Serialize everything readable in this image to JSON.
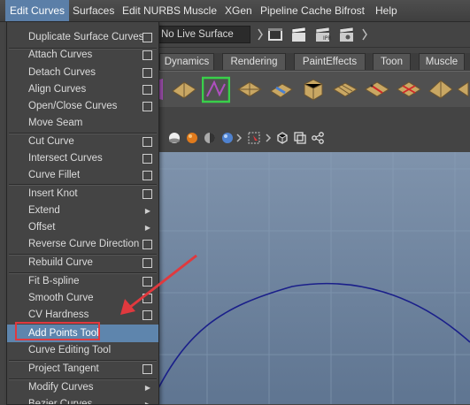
{
  "menubar": {
    "items": [
      {
        "label": "Edit Curves"
      },
      {
        "label": "Surfaces"
      },
      {
        "label": "Edit NURBS"
      },
      {
        "label": "Muscle"
      },
      {
        "label": "XGen"
      },
      {
        "label": "Pipeline Cache"
      },
      {
        "label": "Bifrost"
      },
      {
        "label": "Help"
      }
    ]
  },
  "statusline": {
    "live_surface": "No Live Surface"
  },
  "shelf_tabs": [
    "Dynamics",
    "Rendering",
    "PaintEffects",
    "Toon",
    "Muscle"
  ],
  "menu": {
    "items": [
      {
        "label": "Duplicate Surface Curves",
        "option_box": true
      },
      {
        "label": "Attach Curves",
        "option_box": true
      },
      {
        "label": "Detach Curves",
        "option_box": true
      },
      {
        "label": "Align Curves",
        "option_box": true
      },
      {
        "label": "Open/Close Curves",
        "option_box": true
      },
      {
        "label": "Move Seam",
        "option_box": false
      },
      {
        "label": "Cut Curve",
        "option_box": true
      },
      {
        "label": "Intersect Curves",
        "option_box": true
      },
      {
        "label": "Curve Fillet",
        "option_box": true
      },
      {
        "label": "Insert Knot",
        "option_box": true
      },
      {
        "label": "Extend",
        "submenu": true
      },
      {
        "label": "Offset",
        "submenu": true
      },
      {
        "label": "Reverse Curve Direction",
        "option_box": true
      },
      {
        "label": "Rebuild Curve",
        "option_box": true
      },
      {
        "label": "Fit B-spline",
        "option_box": true
      },
      {
        "label": "Smooth Curve",
        "option_box": true
      },
      {
        "label": "CV Hardness",
        "option_box": true
      },
      {
        "label": "Add Points Tool",
        "highlighted": true
      },
      {
        "label": "Curve Editing Tool"
      },
      {
        "label": "Project Tangent",
        "option_box": true
      },
      {
        "label": "Modify Curves",
        "submenu": true
      },
      {
        "label": "Bezier Curves",
        "submenu": true
      }
    ]
  },
  "colors": {
    "menu_highlight": "#5e85ad",
    "annotation": "#e0393e",
    "curve": "#1a1f8a"
  }
}
